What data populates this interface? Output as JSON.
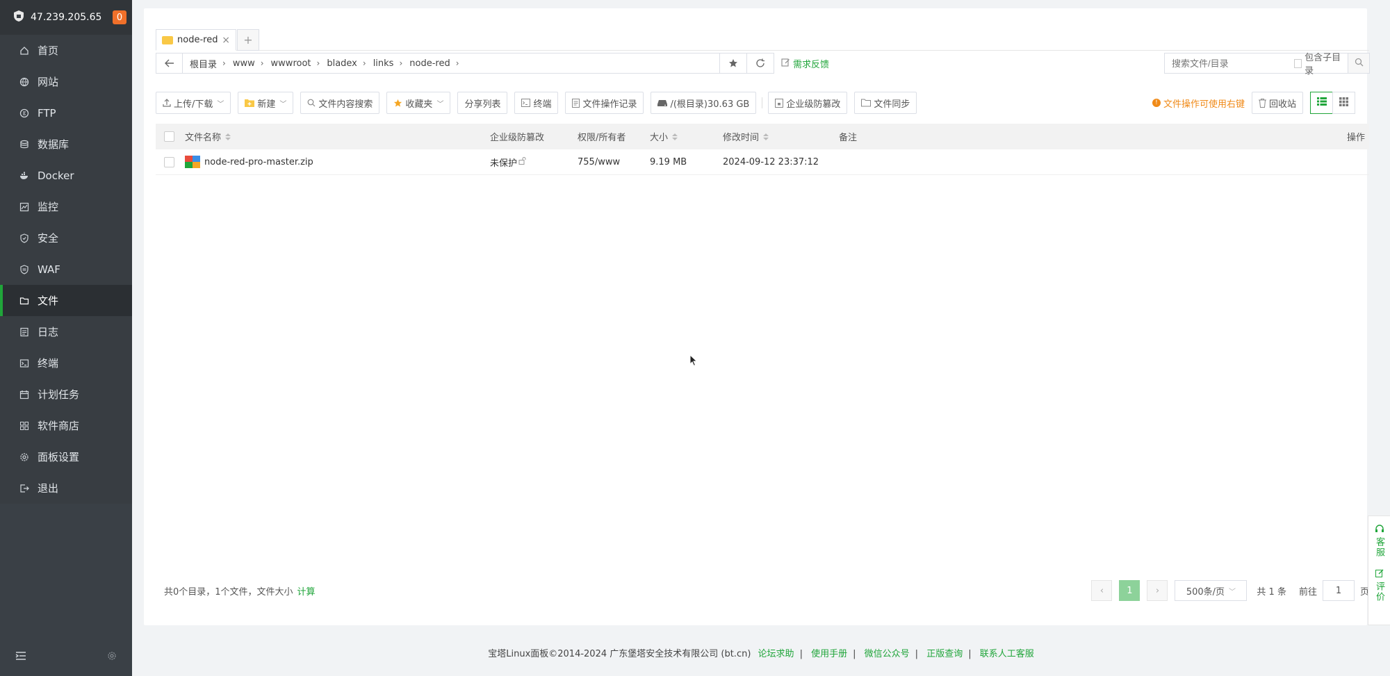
{
  "server": {
    "ip": "47.239.205.65",
    "badge": "0"
  },
  "sidebar": {
    "items": [
      {
        "label": "首页",
        "icon": "home-icon"
      },
      {
        "label": "网站",
        "icon": "globe-icon"
      },
      {
        "label": "FTP",
        "icon": "ftp-icon"
      },
      {
        "label": "数据库",
        "icon": "database-icon"
      },
      {
        "label": "Docker",
        "icon": "docker-icon"
      },
      {
        "label": "监控",
        "icon": "monitor-icon"
      },
      {
        "label": "安全",
        "icon": "shield-icon"
      },
      {
        "label": "WAF",
        "icon": "waf-icon"
      },
      {
        "label": "文件",
        "icon": "folder-icon"
      },
      {
        "label": "日志",
        "icon": "log-icon"
      },
      {
        "label": "终端",
        "icon": "terminal-icon"
      },
      {
        "label": "计划任务",
        "icon": "calendar-icon"
      },
      {
        "label": "软件商店",
        "icon": "apps-icon"
      },
      {
        "label": "面板设置",
        "icon": "gear-icon"
      },
      {
        "label": "退出",
        "icon": "logout-icon"
      }
    ],
    "active_index": 8
  },
  "tabs": {
    "current": "node-red",
    "add": "+"
  },
  "path": {
    "segments": [
      "根目录",
      "www",
      "wwwroot",
      "bladex",
      "links",
      "node-red"
    ],
    "feedback": "需求反馈"
  },
  "search": {
    "placeholder": "搜索文件/目录",
    "include_sub": "包含子目录"
  },
  "toolbar": {
    "upload": "上传/下载",
    "new": "新建",
    "content_search": "文件内容搜索",
    "favorites": "收藏夹",
    "share_list": "分享列表",
    "terminal": "终端",
    "op_log": "文件操作记录",
    "disk": "/(根目录)30.63 GB",
    "tamper": "企业级防篡改",
    "sync": "文件同步",
    "hint": "文件操作可使用右键",
    "recycle": "回收站"
  },
  "table": {
    "headers": {
      "name": "文件名称",
      "tamper": "企业级防篡改",
      "perm": "权限/所有者",
      "size": "大小",
      "mtime": "修改时间",
      "note": "备注",
      "action": "操作"
    },
    "rows": [
      {
        "name": "node-red-pro-master.zip",
        "tamper": "未保护",
        "perm": "755/www",
        "size": "9.19 MB",
        "mtime": "2024-09-12 23:37:12",
        "note": ""
      }
    ]
  },
  "summary": {
    "text": "共0个目录，1个文件，文件大小",
    "calc": "计算"
  },
  "pager": {
    "current": "1",
    "per_page": "500条/页",
    "total": "共 1 条",
    "goto": "前往",
    "goto_value": "1",
    "page_unit": "页"
  },
  "footer": {
    "copyright": "宝塔Linux面板©2014-2024 广东堡塔安全技术有限公司 (bt.cn)",
    "links": [
      "论坛求助",
      "使用手册",
      "微信公众号",
      "正版查询",
      "联系人工客服"
    ]
  },
  "float": {
    "service": "客服",
    "rate": "评价"
  },
  "colors": {
    "accent": "#20a53a",
    "warning": "#f08a18",
    "sidebar": "#3a4046",
    "badge": "#f0702a"
  }
}
